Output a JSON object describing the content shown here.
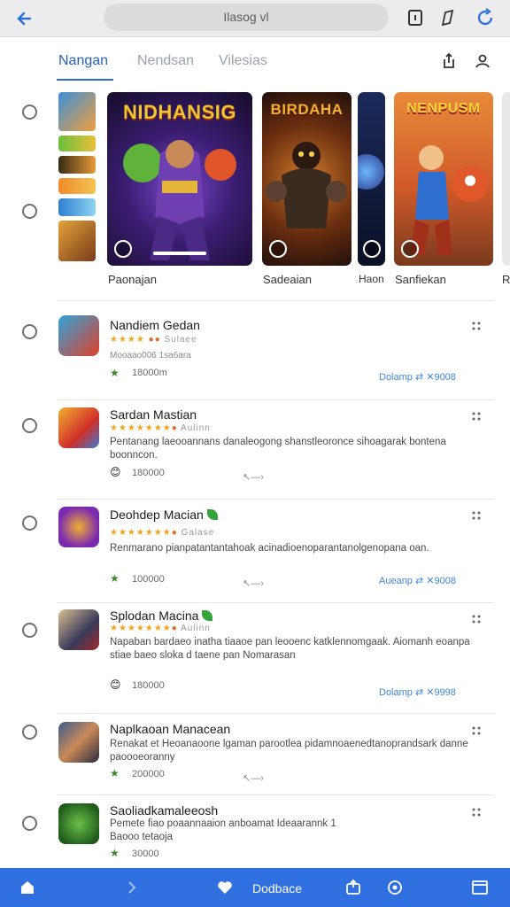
{
  "browser": {
    "address": "Ilasog vl",
    "icons": [
      "back-arrow-icon",
      "tab-count-icon",
      "edit-icon",
      "refresh-icon"
    ]
  },
  "tabs": [
    {
      "label": "Nangan",
      "active": true
    },
    {
      "label": "Nendsan",
      "active": false
    },
    {
      "label": "Vilesias",
      "active": false
    }
  ],
  "tabs_icons": [
    "share-icon",
    "profile-icon"
  ],
  "featured": {
    "cards": [
      {
        "art_title": "NIDHANSIG",
        "label": "Paonajan"
      },
      {
        "art_title": "BIRDAHA",
        "label": "Sadeaian"
      },
      {
        "art_title": "",
        "label": "Haon"
      },
      {
        "art_title": "NENPUSM",
        "label": "Sanfiekan"
      },
      {
        "art_title": "",
        "label": "R"
      }
    ]
  },
  "apps": [
    {
      "name": "Nandiem Gedan",
      "rating_extra": "Sulaee",
      "desc": "Mooaao006 1sa6ara",
      "count_icon": "badge-icon",
      "count": "18000m",
      "action": "Dolamp  ⇄  ✕9008"
    },
    {
      "name": "Sardan Mastian",
      "rating_extra": "Aulinn",
      "desc": "Pentanang laeooannans danaleogong shanstleoronce sihoagarak bontena boonncon.",
      "count_icon": "emoji-icon",
      "count": "180000",
      "action": ""
    },
    {
      "name": "Deohdep Macian",
      "rating_extra": "Galase",
      "desc": "Renmarano pianpatantantahoak acinadioenoparantanolgenopana oan.",
      "count_icon": "badge-icon",
      "count": "100000",
      "action": "Aueanp  ⇄  ✕9008"
    },
    {
      "name": "Splodan Macina",
      "rating_extra": "Aulinn",
      "desc": "Napaban bardaeo inatha tiaaoe pan leooenc katklennomgaak. Aiomanh eoanpa stiae baeo sloka d taene pan Nomarasan",
      "count_icon": "emoji-icon",
      "count": "180000",
      "action": "Dolamp  ⇄  ✕9998"
    },
    {
      "name": "Naplkaoan Manacean",
      "rating_extra": "",
      "desc": "Renakat et Heoanaoone lgaman parootlea pidamnoaenedtanoprandsark danne paoooeoranny",
      "count_icon": "badge-icon",
      "count": "200000",
      "action": ""
    },
    {
      "name": "Saoliadkamaleeosh",
      "rating_extra": "",
      "desc": "Pemete fiao poaannaaion anboamat Ideaarannk 1 Baooo tetaoja",
      "count_icon": "badge-icon",
      "count": "30000",
      "action": ""
    }
  ],
  "bottom_nav": {
    "label": "Dodbace",
    "icons": [
      "home-icon",
      "chevron-right-icon",
      "heart-icon",
      "share-icon",
      "settings-icon",
      "window-icon"
    ]
  },
  "colors": {
    "accent": "#2a6fd6",
    "bottom_nav": "#2f6fe0",
    "star": "#f2a416"
  }
}
